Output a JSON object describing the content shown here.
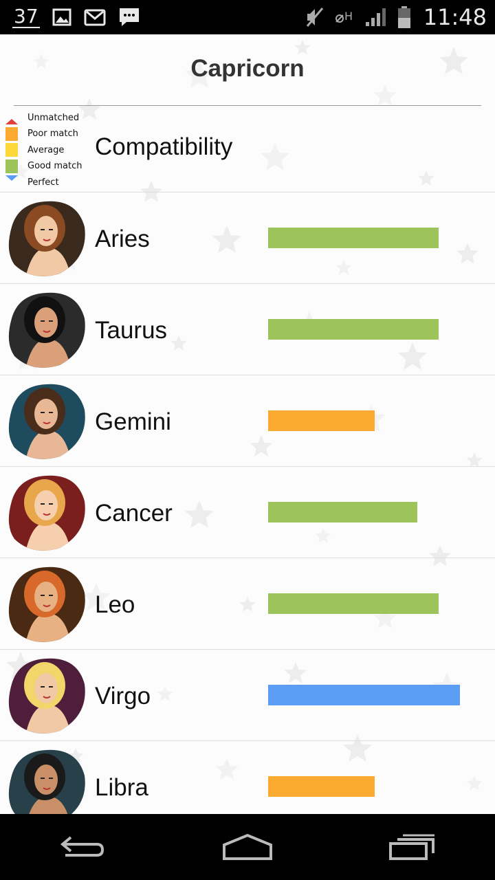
{
  "status_bar": {
    "notification_count": "37",
    "clock": "11:48",
    "left_icons": [
      "image-icon",
      "gmail-icon",
      "message-icon"
    ],
    "right_icons": [
      "mute-icon",
      "data-h-icon",
      "signal-icon",
      "battery-icon"
    ]
  },
  "header": {
    "title": "Capricorn"
  },
  "legend": {
    "heading": "Compatibility",
    "items": [
      {
        "label": "Unmatched",
        "color": "#e0403a"
      },
      {
        "label": "Poor match",
        "color": "#fbaa2f"
      },
      {
        "label": "Average",
        "color": "#fcd83a"
      },
      {
        "label": "Good match",
        "color": "#9cc45a"
      },
      {
        "label": "Perfect",
        "color": "#5b9cf4"
      }
    ]
  },
  "signs": [
    {
      "name": "Aries",
      "level": "Good match",
      "score": 0.8,
      "color": "#9cc45a",
      "hair": "#8a4a22",
      "skin": "#f1c9a5",
      "bg": "#3a2a1e"
    },
    {
      "name": "Taurus",
      "level": "Good match",
      "score": 0.8,
      "color": "#9cc45a",
      "hair": "#111111",
      "skin": "#d9a07a",
      "bg": "#2b2b2b"
    },
    {
      "name": "Gemini",
      "level": "Poor match",
      "score": 0.5,
      "color": "#fbaa2f",
      "hair": "#4a2c1a",
      "skin": "#e8b896",
      "bg": "#1f4b5e"
    },
    {
      "name": "Cancer",
      "level": "Good match",
      "score": 0.7,
      "color": "#9cc45a",
      "hair": "#e8a74a",
      "skin": "#f5cfae",
      "bg": "#7a1e1e"
    },
    {
      "name": "Leo",
      "level": "Good match",
      "score": 0.8,
      "color": "#9cc45a",
      "hair": "#d9692a",
      "skin": "#e7b183",
      "bg": "#4a2a12"
    },
    {
      "name": "Virgo",
      "level": "Perfect",
      "score": 0.9,
      "color": "#5b9cf4",
      "hair": "#f2d66a",
      "skin": "#f1c9a5",
      "bg": "#4e1e3a"
    },
    {
      "name": "Libra",
      "level": "Poor match",
      "score": 0.5,
      "color": "#fbaa2f",
      "hair": "#1a1a1a",
      "skin": "#c98f66",
      "bg": "#27404a"
    }
  ],
  "nav_bar": {
    "buttons": [
      "back-icon",
      "home-icon",
      "recents-icon"
    ]
  }
}
